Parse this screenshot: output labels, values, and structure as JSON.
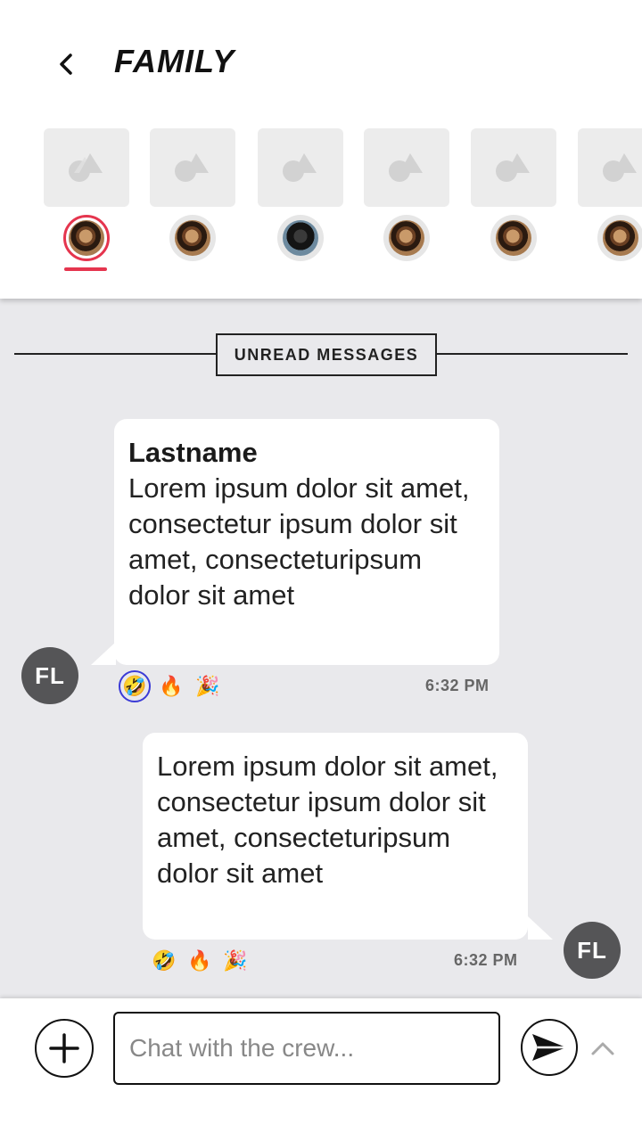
{
  "header": {
    "title": "FAMILY",
    "back_icon": "chevron-left-icon"
  },
  "members": [
    {
      "face": "face-a",
      "active": true
    },
    {
      "face": "face-a",
      "active": false
    },
    {
      "face": "face-b",
      "active": false
    },
    {
      "face": "face-a",
      "active": false
    },
    {
      "face": "face-a",
      "active": false
    },
    {
      "face": "face-a",
      "active": false
    }
  ],
  "divider": {
    "label": "UNREAD MESSAGES"
  },
  "messages": [
    {
      "sender": "Lastname",
      "text": "Lorem ipsum dolor sit amet, consectetur ipsum dolor sit amet, consecteturipsum dolor sit amet",
      "initials": "FL",
      "time": "6:32 PM",
      "reactions": [
        "🤣",
        "🔥",
        "🎉"
      ],
      "selected_reaction": "🤣"
    },
    {
      "text": "Lorem ipsum dolor sit amet, consectetur ipsum dolor sit amet, consecteturipsum dolor sit amet",
      "initials": "FL",
      "time": "6:32 PM",
      "reactions": [
        "🤣",
        "🔥",
        "🎉"
      ]
    }
  ],
  "composer": {
    "placeholder": "Chat with the crew...",
    "add_icon": "plus-icon",
    "send_icon": "send-icon",
    "expand_icon": "chevron-up-icon"
  },
  "colors": {
    "accent": "#e5354e",
    "selected_reaction_ring": "#3b3bd6",
    "background": "#e9e9ec"
  }
}
